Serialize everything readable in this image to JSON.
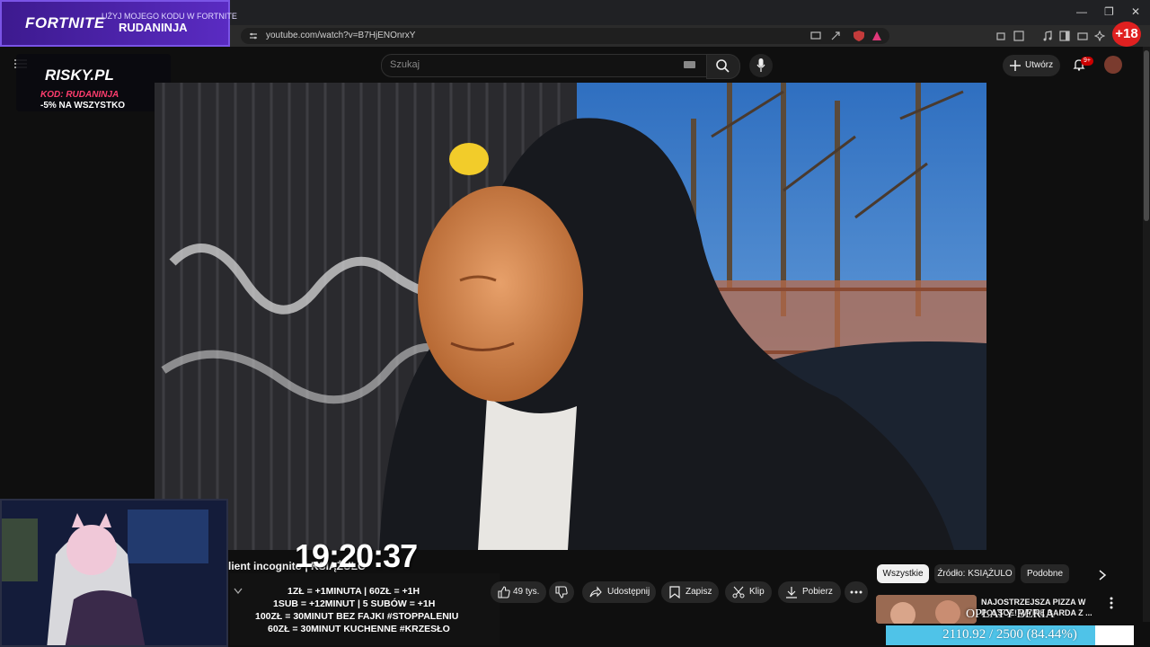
{
  "browser": {
    "url": "youtube.com/watch?v=B7HjENOnrxY",
    "age_badge": "+18"
  },
  "overlay": {
    "fortnite_logo": "FORTNITE",
    "fortnite_sub": "UŻYJ MOJEGO KODU W FORTNITE",
    "fortnite_name": "RUDANINJA",
    "risky_logo": "RISKY.PL",
    "risky_code": "KOD: RUDANINJA",
    "risky_discount": "-5% NA WSZYSTKO",
    "clock": "19:20:37",
    "rules": [
      "1ZŁ = +1MINUTA | 60ZŁ = +1H",
      "1SUB = +12MINUT | 5 SUBÓW = +1H",
      "100ZŁ = 30MINUT BEZ FAJKI #STOPPALENIU",
      "60ZŁ = 30MINUT KUCHENNE #KRZESŁO"
    ],
    "opaty": "OPŁATY BERIA",
    "progress_text": "2110.92 / 2500 (84.44%)",
    "progress_fraction": 0.8444
  },
  "header": {
    "search_placeholder": "Szukaj",
    "create_label": "Utwórz",
    "notifications_badge": "9+"
  },
  "video": {
    "title_fragment": "lient incognito | KSIĄŻULO"
  },
  "actions": {
    "likes": "49 tys.",
    "share": "Udostępnij",
    "save": "Zapisz",
    "clip": "Klip",
    "download": "Pobierz"
  },
  "chips": [
    "Wszystkie",
    "Źródło: KSIĄŻULO",
    "Podobne"
  ],
  "recommendation": {
    "title": "NAJOSTRZEJSZA PIZZA W POLSCE! WYPIŁ BARDA Z ..."
  },
  "colors": {
    "youtube_bg": "#0f0f0f",
    "fortnite_purple": "#5a2bc2",
    "risky_pink": "#ff3d6e",
    "progress_cyan": "#4fc3e8",
    "badge_red": "#e02020"
  }
}
